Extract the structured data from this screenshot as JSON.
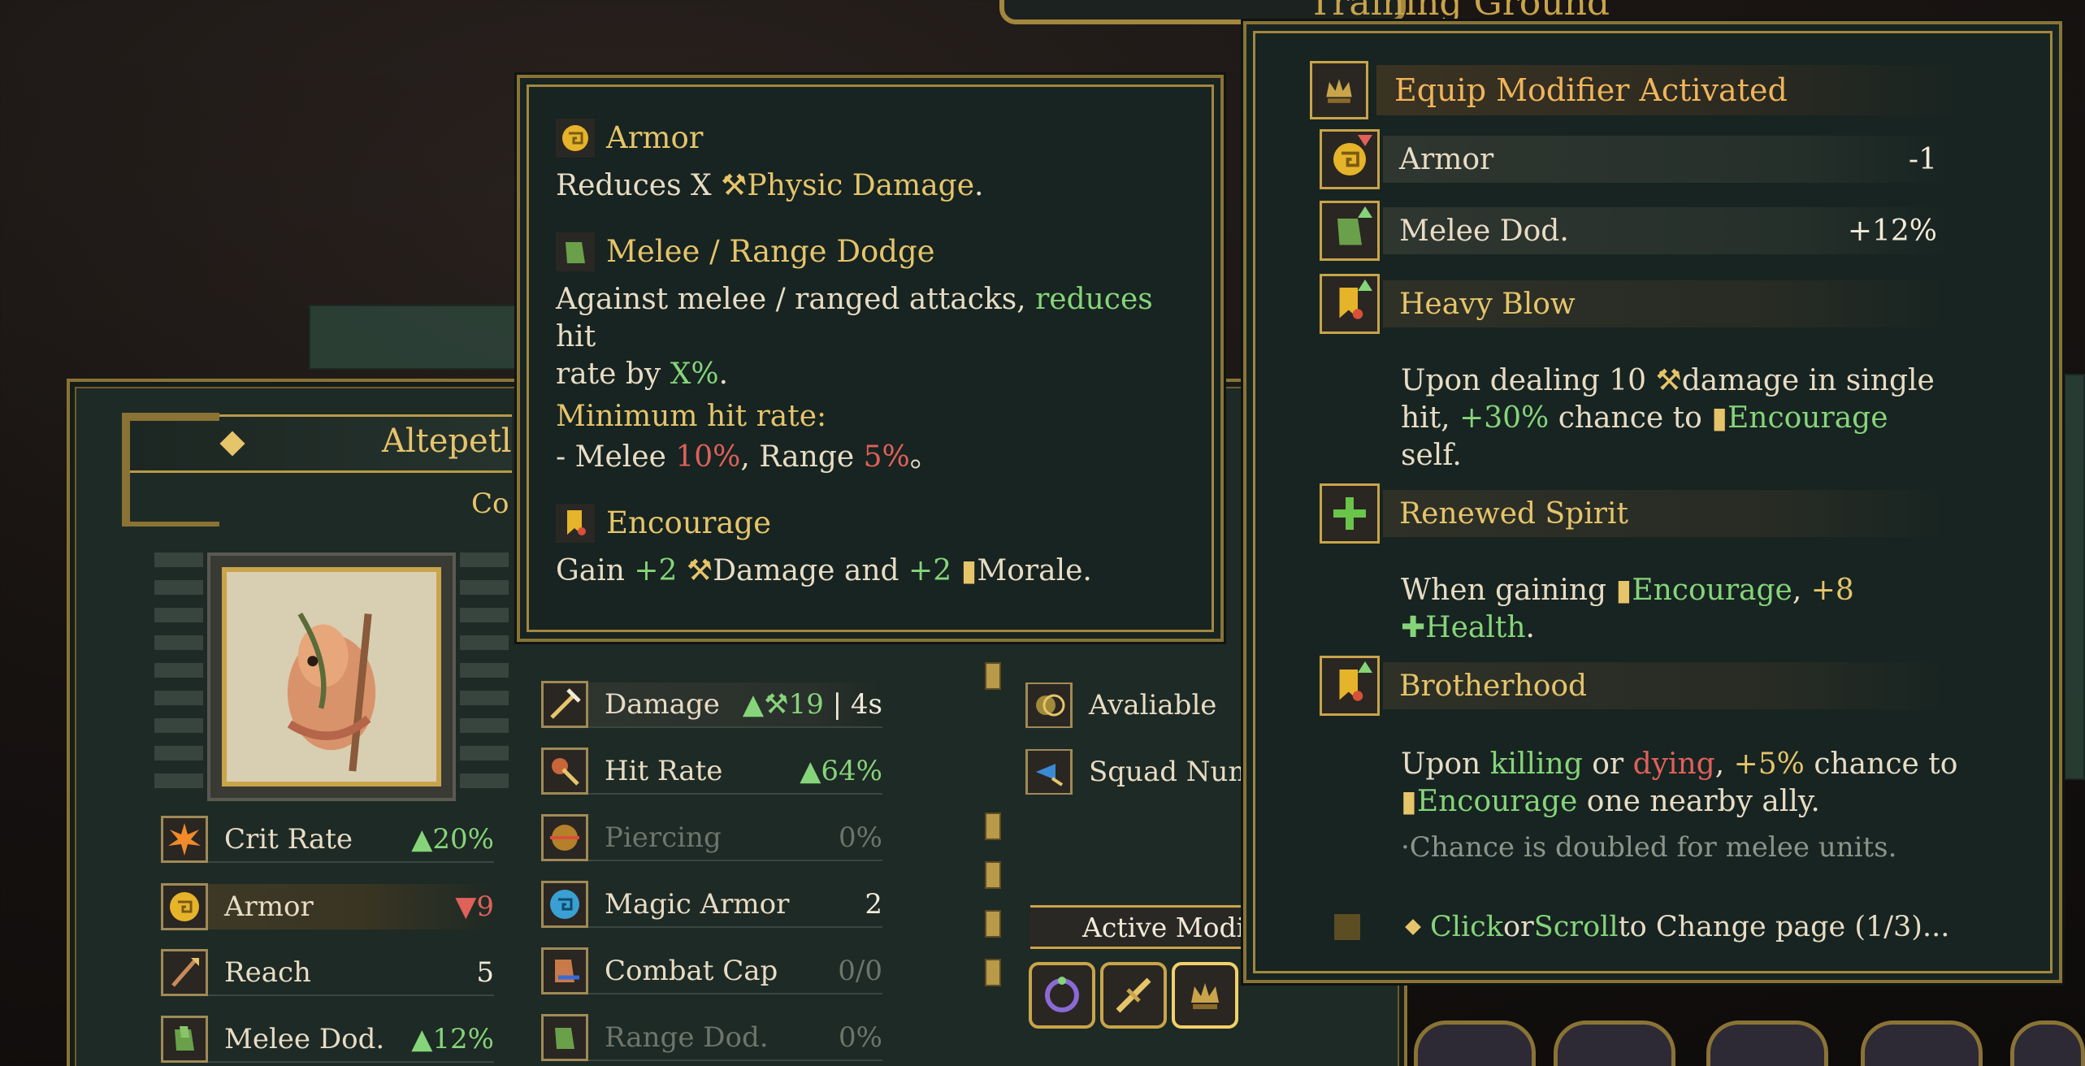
{
  "top": {
    "location_title": "Training Ground"
  },
  "unit": {
    "name": "Altepetl",
    "subtitle": "Co",
    "stats_left": [
      {
        "icon": "crit-rate-icon",
        "label": "Crit Rate",
        "value": "20%",
        "trend": "up"
      },
      {
        "icon": "armor-icon",
        "label": "Armor",
        "value": "9",
        "trend": "down"
      },
      {
        "icon": "reach-icon",
        "label": "Reach",
        "value": "5",
        "trend": "none"
      },
      {
        "icon": "melee-dodge-icon",
        "label": "Melee Dod.",
        "value": "12%",
        "trend": "up"
      }
    ],
    "stats_mid": [
      {
        "icon": "damage-icon",
        "label": "Damage",
        "value": "19",
        "extra": "4s",
        "trend": "up",
        "disabled": false
      },
      {
        "icon": "hit-rate-icon",
        "label": "Hit Rate",
        "value": "64%",
        "trend": "up",
        "disabled": false
      },
      {
        "icon": "piercing-icon",
        "label": "Piercing",
        "value": "0%",
        "trend": "none",
        "disabled": true
      },
      {
        "icon": "magic-armor-icon",
        "label": "Magic Armor",
        "value": "2",
        "trend": "none",
        "disabled": false
      },
      {
        "icon": "combat-cap-icon",
        "label": "Combat Cap",
        "value": "0/0",
        "trend": "none",
        "disabled": true
      },
      {
        "icon": "range-dodge-icon",
        "label": "Range Dod.",
        "value": "0%",
        "trend": "none",
        "disabled": true
      }
    ],
    "stats_right": [
      {
        "icon": "avaliable-icon",
        "label": "Avaliable"
      },
      {
        "icon": "squad-number-icon",
        "label": "Squad Num"
      }
    ],
    "active_modifiers_label": "Active Modi"
  },
  "tooltip_glossary": {
    "armor": {
      "title": "Armor",
      "prefix": "Reduces X ",
      "highlight": "Physic Damage",
      "suffix": "."
    },
    "dodge": {
      "title": "Melee / Range Dodge",
      "line_a": "Against melee / ranged attacks, ",
      "line_hl": "reduces",
      "line_b": " hit",
      "line_c": "rate by ",
      "line_pct": "X%",
      "line_d": ".",
      "min_label": "Minimum hit rate:",
      "min_a": "- Melee ",
      "min_melee": "10%",
      "min_b": ", Range ",
      "min_range": "5%",
      "min_c": "。"
    },
    "encourage": {
      "title": "Encourage",
      "a": "Gain ",
      "v1": "+2",
      "b": "Damage and ",
      "v2": "+2",
      "c": "Morale."
    }
  },
  "tooltip_modifier": {
    "title": "Equip Modifier Activated",
    "rows": [
      {
        "icon": "armor-icon",
        "label": "Armor",
        "value": "-1"
      },
      {
        "icon": "melee-dodge-icon",
        "label": "Melee Dod.",
        "value": "+12%"
      }
    ],
    "heavy_blow": {
      "title": "Heavy Blow",
      "a": "Upon dealing 10 ",
      "b": "damage in single",
      "c": "hit, ",
      "pct": "+30%",
      "d": " chance to ",
      "enc": "Encourage",
      "e": "self."
    },
    "renewed_spirit": {
      "title": "Renewed Spirit",
      "a": "When gaining ",
      "enc": "Encourage",
      "b": ", ",
      "val": "+8",
      "health": "Health",
      "c": "."
    },
    "brotherhood": {
      "title": "Brotherhood",
      "a": "Upon ",
      "killing": "killing",
      "b": " or ",
      "dying": "dying",
      "c": ", ",
      "pct": "+5%",
      "d": " chance to",
      "enc": "Encourage",
      "e": " one nearby ally.",
      "note": "·Chance is doubled for melee units."
    },
    "footer": {
      "click": "Click",
      "or": " or ",
      "scroll": "Scroll",
      "rest": " to Change page (1/3)..."
    }
  },
  "colors": {
    "gold": "#e6c46a",
    "green": "#86d47a",
    "red": "#e0605a",
    "panel": "#172421",
    "frame": "#8a7335"
  }
}
